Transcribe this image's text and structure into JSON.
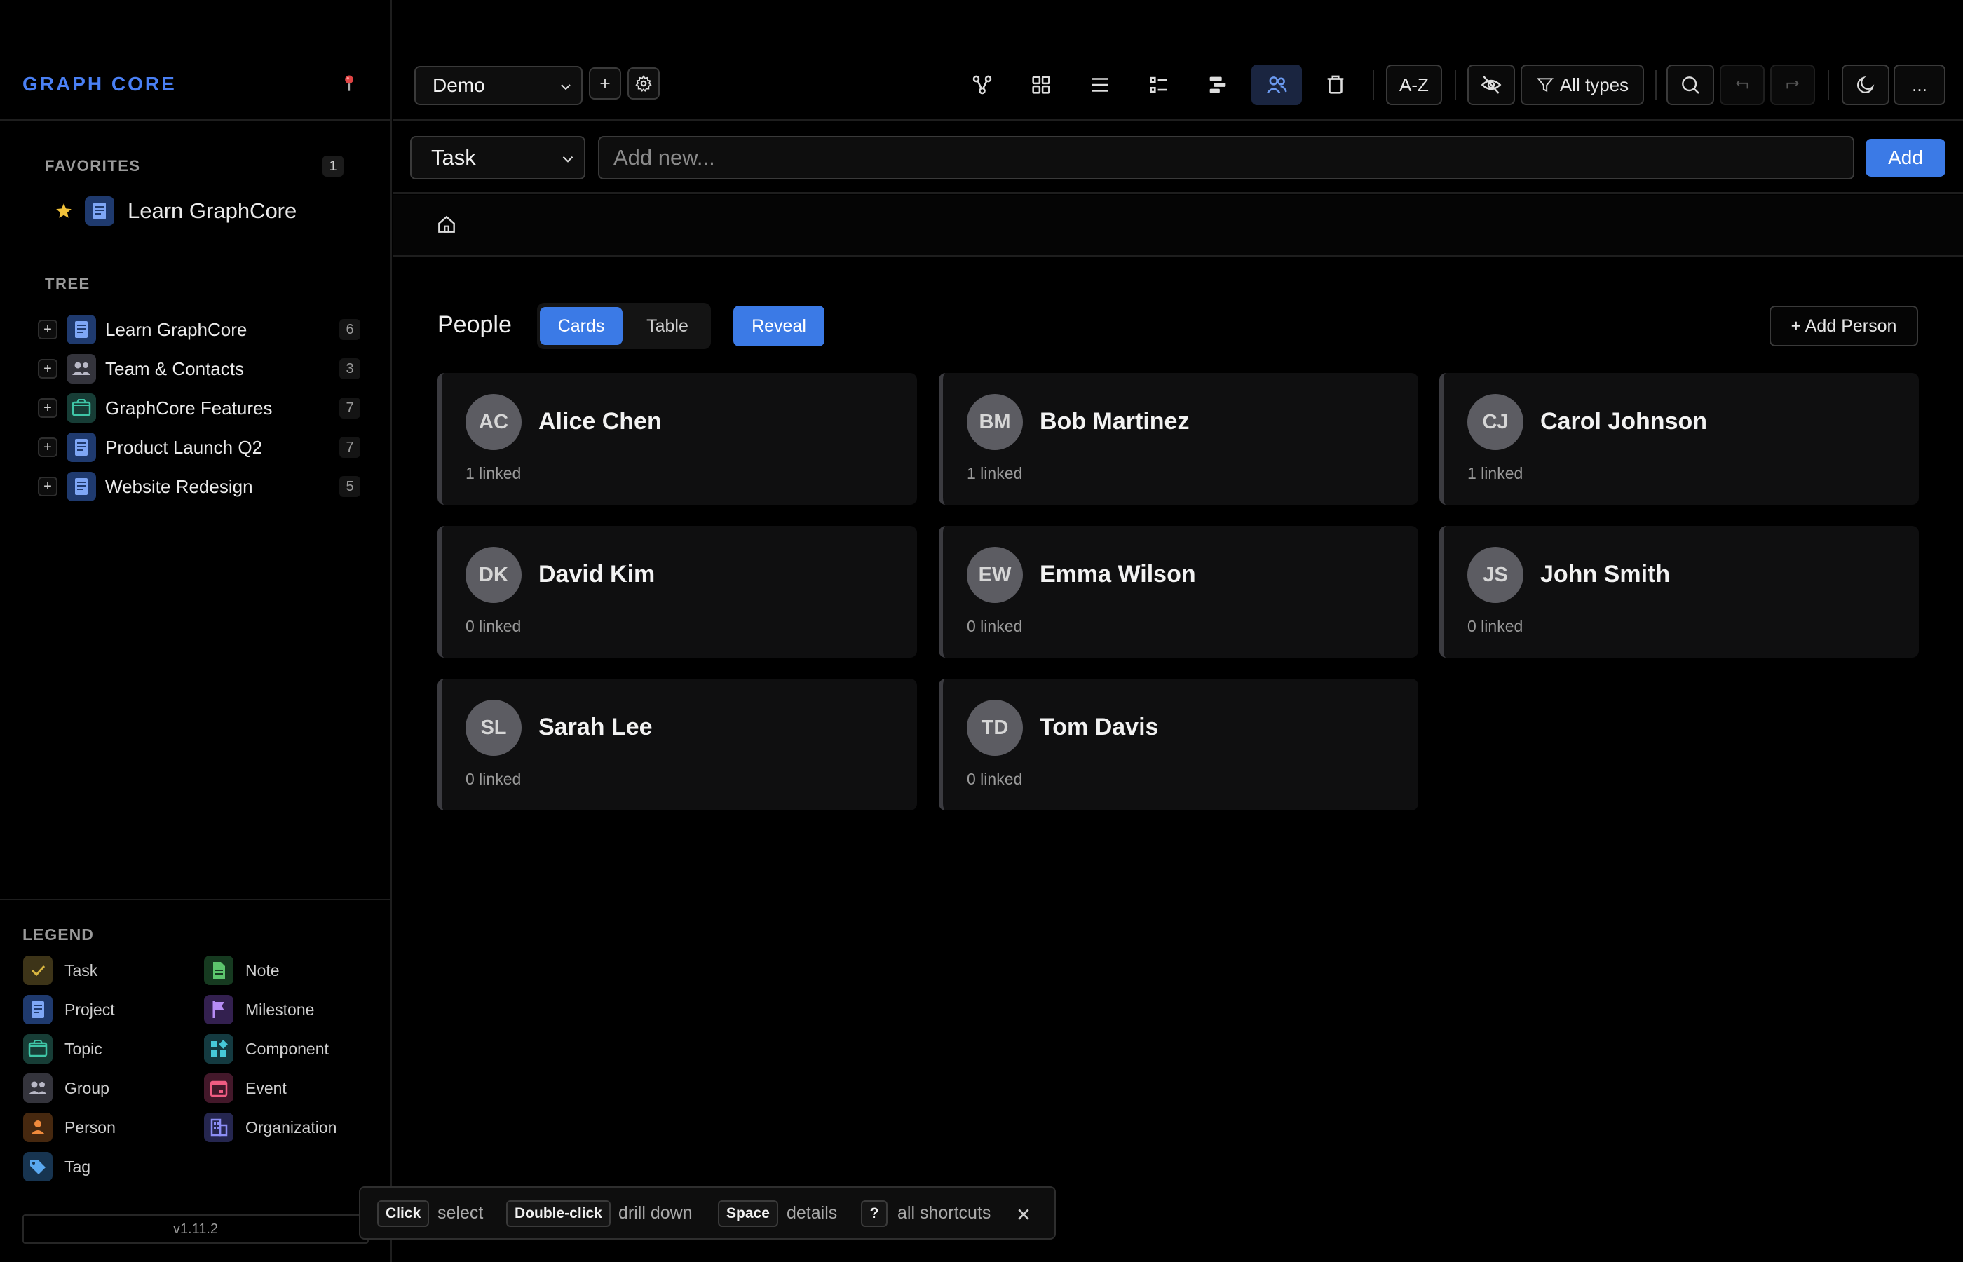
{
  "sidebar": {
    "brand": "GRAPH CORE",
    "favorites": {
      "title": "FAVORITES",
      "count": "1",
      "items": [
        {
          "label": "Learn GraphCore",
          "icon": "project-icon"
        }
      ]
    },
    "tree": {
      "title": "TREE",
      "items": [
        {
          "label": "Learn GraphCore",
          "count": "6",
          "icon": "project-icon"
        },
        {
          "label": "Team & Contacts",
          "count": "3",
          "icon": "group-icon"
        },
        {
          "label": "GraphCore Features",
          "count": "7",
          "icon": "topic-icon"
        },
        {
          "label": "Product Launch Q2",
          "count": "7",
          "icon": "project-icon"
        },
        {
          "label": "Website Redesign",
          "count": "5",
          "icon": "project-icon"
        }
      ]
    },
    "legend": {
      "title": "LEGEND",
      "items": [
        {
          "label": "Task",
          "icon": "check-icon",
          "color": "#d9b640"
        },
        {
          "label": "Note",
          "icon": "note-icon",
          "color": "#5cc46c"
        },
        {
          "label": "Project",
          "icon": "project-icon",
          "color": "#6b9af0"
        },
        {
          "label": "Milestone",
          "icon": "flag-icon",
          "color": "#b78cf5"
        },
        {
          "label": "Topic",
          "icon": "folder-icon",
          "color": "#3fc6a7"
        },
        {
          "label": "Component",
          "icon": "grid-icon",
          "color": "#46c9d8"
        },
        {
          "label": "Group",
          "icon": "group-icon",
          "color": "#a8a8b8"
        },
        {
          "label": "Event",
          "icon": "calendar-icon",
          "color": "#ef5c82"
        },
        {
          "label": "Person",
          "icon": "person-icon",
          "color": "#f08a3c"
        },
        {
          "label": "Organization",
          "icon": "building-icon",
          "color": "#8c8ef5"
        },
        {
          "label": "Tag",
          "icon": "tag-icon",
          "color": "#5aa8f0"
        }
      ]
    },
    "version": "v1.11.2"
  },
  "toolbar": {
    "project": "Demo",
    "sort_label": "A-Z",
    "filter_label": "All types",
    "view_icons": [
      "graph-icon",
      "grid-view-icon",
      "list-icon",
      "checklist-icon",
      "timeline-icon",
      "people-icon",
      "trash-icon"
    ],
    "active_view": "people-icon",
    "overflow_label": "..."
  },
  "addbar": {
    "type": "Task",
    "placeholder": "Add new...",
    "add_label": "Add"
  },
  "people_view": {
    "title": "People",
    "tabs": [
      "Cards",
      "Table"
    ],
    "active_tab": "Cards",
    "reveal_label": "Reveal",
    "add_person_label": "+ Add Person",
    "people": [
      {
        "initials": "AC",
        "name": "Alice Chen",
        "linked": "1 linked"
      },
      {
        "initials": "BM",
        "name": "Bob Martinez",
        "linked": "1 linked"
      },
      {
        "initials": "CJ",
        "name": "Carol Johnson",
        "linked": "1 linked"
      },
      {
        "initials": "DK",
        "name": "David Kim",
        "linked": "0 linked"
      },
      {
        "initials": "EW",
        "name": "Emma Wilson",
        "linked": "0 linked"
      },
      {
        "initials": "JS",
        "name": "John Smith",
        "linked": "0 linked"
      },
      {
        "initials": "SL",
        "name": "Sarah Lee",
        "linked": "0 linked"
      },
      {
        "initials": "TD",
        "name": "Tom Davis",
        "linked": "0 linked"
      }
    ]
  },
  "shortcuts": [
    {
      "key": "Click",
      "desc": "select"
    },
    {
      "key": "Double-click",
      "desc": "drill down"
    },
    {
      "key": "Space",
      "desc": "details"
    },
    {
      "key": "?",
      "desc": "all shortcuts"
    }
  ],
  "colors": {
    "accent": "#3b7ae6",
    "brand": "#4a80f5",
    "background": "#000000",
    "card": "#0f0f10"
  }
}
